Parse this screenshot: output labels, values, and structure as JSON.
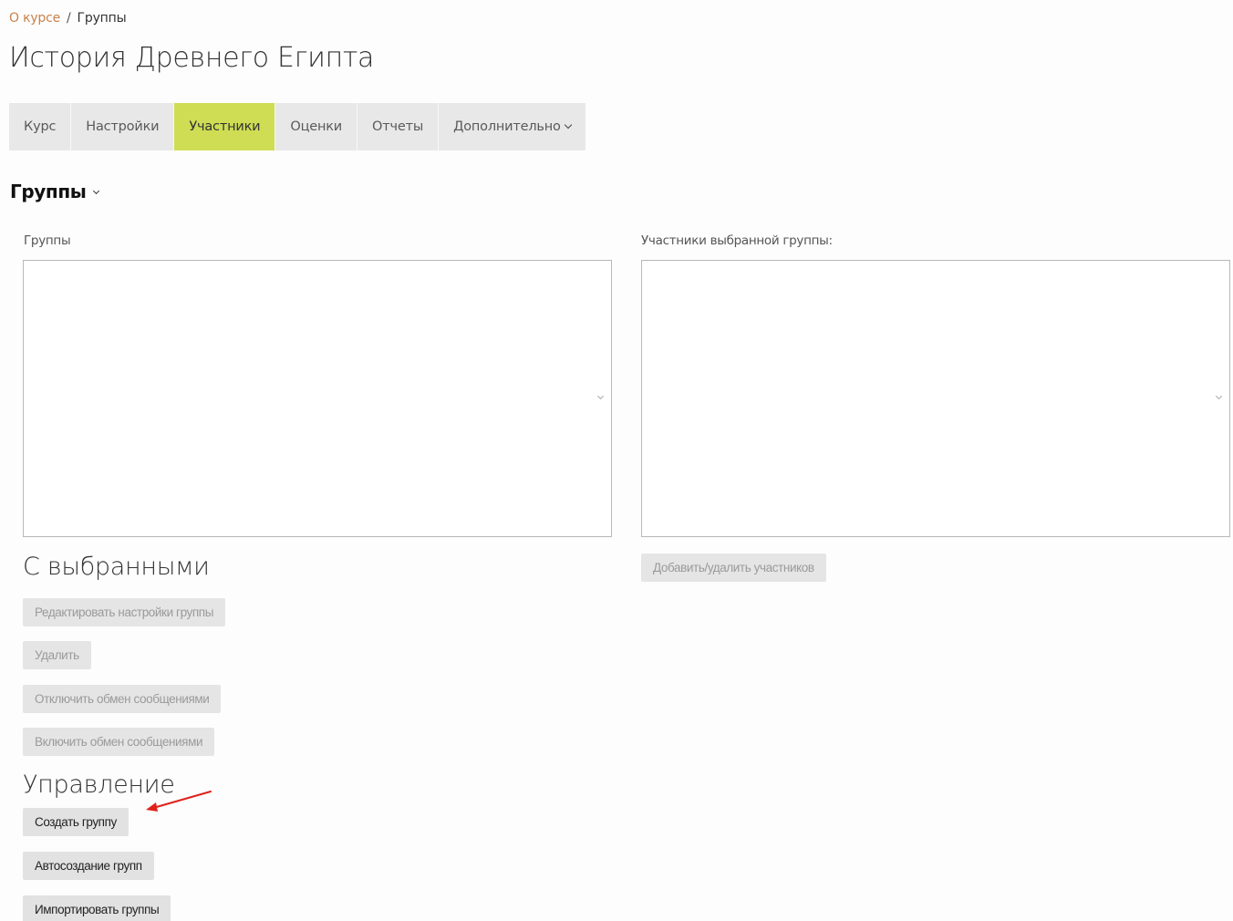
{
  "breadcrumb": {
    "link": "О курсе",
    "separator": "/",
    "current": "Группы"
  },
  "page_title": "История Древнего Египта",
  "tabs": [
    {
      "label": "Курс",
      "active": false
    },
    {
      "label": "Настройки",
      "active": false
    },
    {
      "label": "Участники",
      "active": true
    },
    {
      "label": "Оценки",
      "active": false
    },
    {
      "label": "Отчеты",
      "active": false
    },
    {
      "label": "Дополнительно",
      "active": false,
      "dropdown": true
    }
  ],
  "section_title": "Группы",
  "groups_panel": {
    "label": "Группы"
  },
  "members_panel": {
    "label": "Участники выбранной группы:",
    "add_remove_button": "Добавить/удалить участников"
  },
  "with_selected": {
    "heading": "С выбранными",
    "edit_button": "Редактировать настройки группы",
    "delete_button": "Удалить",
    "disable_messaging_button": "Отключить обмен сообщениями",
    "enable_messaging_button": "Включить обмен сообщениями"
  },
  "management": {
    "heading": "Управление",
    "create_group_button": "Создать группу",
    "auto_create_button": "Автосоздание групп",
    "import_button": "Импортировать группы"
  },
  "colors": {
    "active_tab": "#cedd54",
    "breadcrumb_link": "#c9814a",
    "annotation_arrow": "#e0211b"
  },
  "icons": {
    "tab_dropdown": "chevron-down-icon",
    "section_dropdown": "chevron-down-icon",
    "annotation": "red-arrow-icon"
  }
}
